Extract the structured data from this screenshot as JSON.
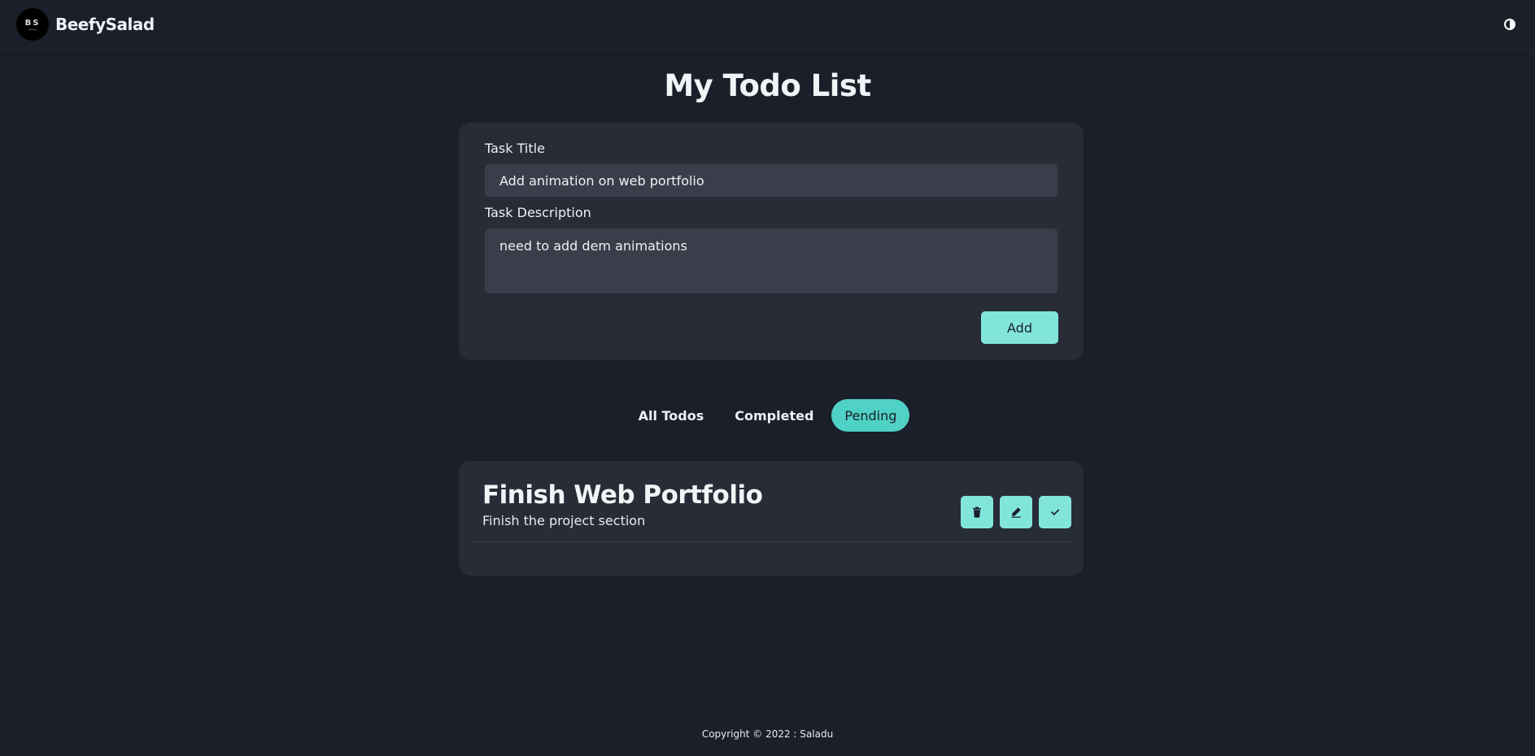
{
  "nav": {
    "logo_text": "BS",
    "brand": "BeefySalad",
    "theme_icon": "contrast-icon"
  },
  "page": {
    "title": "My Todo List"
  },
  "form": {
    "title_label": "Task Title",
    "title_value": "Add animation on web portfolio",
    "description_label": "Task Description",
    "description_value": "need to add dem animations",
    "add_label": "Add"
  },
  "filters": {
    "tabs": [
      {
        "label": "All Todos",
        "active": false
      },
      {
        "label": "Completed",
        "active": false
      },
      {
        "label": "Pending",
        "active": true
      }
    ]
  },
  "todos": [
    {
      "title": "Finish Web Portfolio",
      "description": "Finish the project section",
      "actions": [
        "trash-icon",
        "edit-icon",
        "check-icon"
      ]
    }
  ],
  "footer": {
    "text": "Copyright © 2022 : Saladu"
  },
  "colors": {
    "background": "#1b1f2a",
    "card": "#282c37",
    "input": "#3b3e4a",
    "accent": "#81e6d9",
    "active_tab": "#4fd1c5"
  }
}
